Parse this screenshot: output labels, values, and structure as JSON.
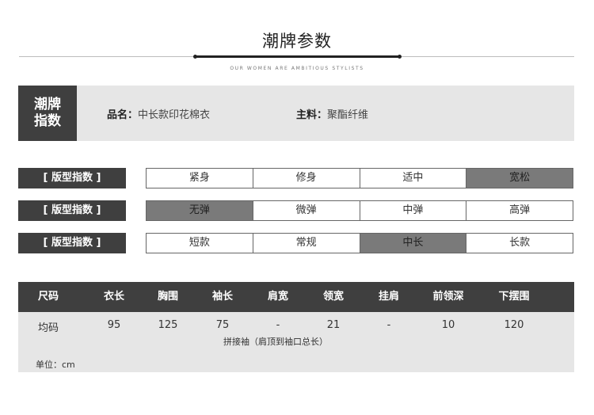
{
  "header": {
    "title": "潮牌参数",
    "subtitle": "OUR WOMEN ARE AMBITIOUS STYLISTS"
  },
  "info": {
    "index_label_line1": "潮牌",
    "index_label_line2": "指数",
    "product_name_label": "品名：",
    "product_name_value": "中长款印花棉衣",
    "material_label": "主料：",
    "material_value": "聚酯纤维"
  },
  "index_rows": [
    {
      "label": "[ 版型指数 ]",
      "options": [
        "紧身",
        "修身",
        "适中",
        "宽松"
      ],
      "selected": 3
    },
    {
      "label": "[ 版型指数 ]",
      "options": [
        "无弹",
        "微弹",
        "中弹",
        "高弹"
      ],
      "selected": 0
    },
    {
      "label": "[ 版型指数 ]",
      "options": [
        "短款",
        "常规",
        "中长",
        "长款"
      ],
      "selected": 2
    }
  ],
  "size_table": {
    "headers": [
      "尺码",
      "衣长",
      "胸围",
      "袖长",
      "肩宽",
      "领宽",
      "挂肩",
      "前领深",
      "下摆围"
    ],
    "row": [
      "均码",
      "95",
      "125",
      "75",
      "-",
      "21",
      "-",
      "10",
      "120"
    ],
    "sleeve_note": "拼接袖（肩顶到袖口总长）",
    "unit": "单位：cm"
  },
  "colors": {
    "dark_block": "#3f3f3f",
    "selected_option": "#7a7a7a",
    "panel_bg": "#e6e6e6"
  }
}
